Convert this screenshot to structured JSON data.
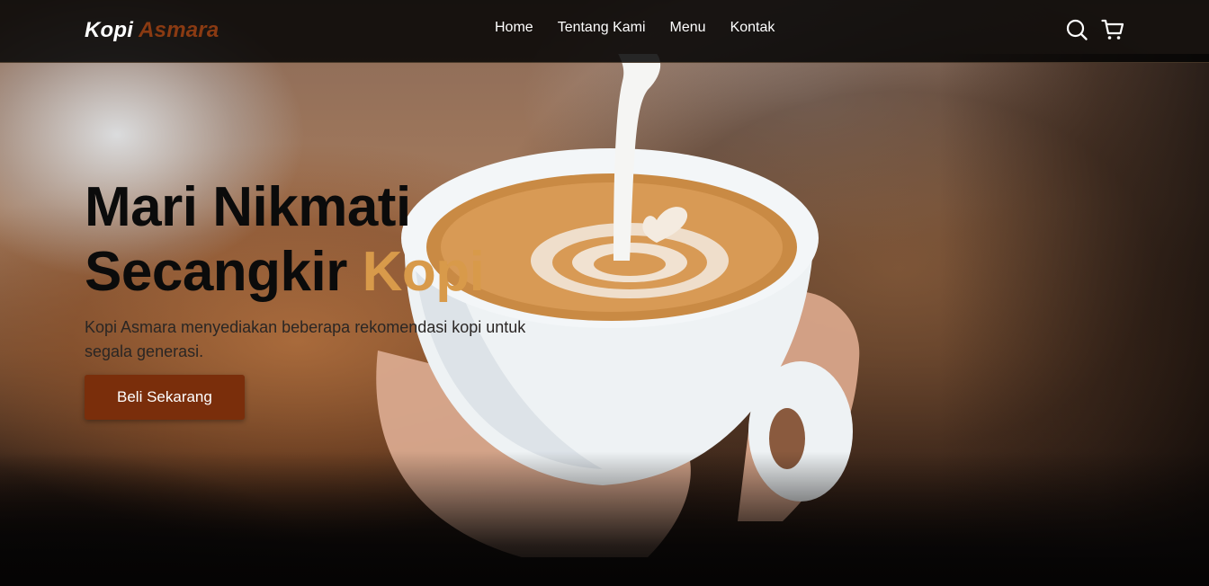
{
  "brand": {
    "name_part1": "Kopi",
    "name_part2": "Asmara",
    "accent_color": "#8a3a12",
    "highlight_color": "#d89a4a"
  },
  "nav": {
    "links": [
      "Home",
      "Tentang Kami",
      "Menu",
      "Kontak"
    ],
    "icons": [
      "search-icon",
      "shopping-cart-icon"
    ]
  },
  "hero": {
    "headline_line1": "Mari Nikmati",
    "headline_line2_prefix": "Secangkir",
    "headline_line2_accent": "Kopi",
    "subtitle": "Kopi Asmara menyediakan beberapa rekomendasi kopi untuk segala generasi.",
    "cta_label": "Beli Sekarang",
    "cta_color": "#7a2e0b"
  }
}
